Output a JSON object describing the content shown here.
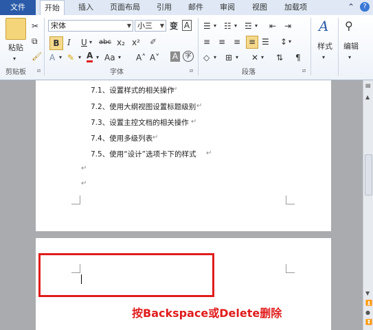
{
  "tabs": {
    "file": "文件",
    "home": "开始",
    "insert": "插入",
    "layout": "页面布局",
    "references": "引用",
    "mailings": "邮件",
    "review": "审阅",
    "view": "视图",
    "addins": "加载项"
  },
  "ribbon": {
    "clipboard": {
      "paste": "粘贴",
      "label": "剪贴板"
    },
    "font": {
      "name": "宋体",
      "size": "小三",
      "phonetic": "变",
      "border_char": "A",
      "bold": "B",
      "italic": "I",
      "underline": "U",
      "strike": "abc",
      "subscript": "x₂",
      "superscript": "x²",
      "font_color": "A",
      "change_case": "Aa",
      "grow": "A˄",
      "shrink": "A˅",
      "shade_char": "A",
      "enclose": "字",
      "label": "字体"
    },
    "paragraph": {
      "label": "段落"
    },
    "styles": {
      "label": "样式"
    },
    "editing": {
      "label": "编辑"
    }
  },
  "document": {
    "toc": [
      "7.1、设置样式的相关操作",
      "7.2、使用大纲视图设置标题级别",
      "7.3、设置主控文档的相关操作",
      "7.4、使用多级列表",
      "7.5、使用“设计”选项卡下的样式"
    ],
    "pilcrow": "↵"
  },
  "annotation": "按Backspace或Delete删除",
  "colors": {
    "accent": "#2a5aa8",
    "highlight": "#e01c1c",
    "font_color_bar": "#e01c1c"
  }
}
